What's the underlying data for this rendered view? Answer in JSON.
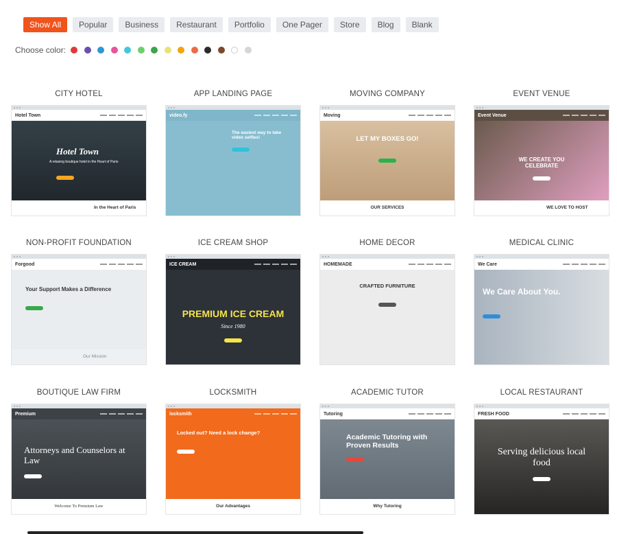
{
  "filters": [
    {
      "label": "Show All",
      "active": true
    },
    {
      "label": "Popular"
    },
    {
      "label": "Business"
    },
    {
      "label": "Restaurant"
    },
    {
      "label": "Portfolio"
    },
    {
      "label": "One Pager"
    },
    {
      "label": "Store"
    },
    {
      "label": "Blog"
    },
    {
      "label": "Blank"
    }
  ],
  "color_picker": {
    "label": "Choose color:",
    "colors": [
      "#e0393b",
      "#6a4fb0",
      "#2f97d4",
      "#e8559a",
      "#40c9d9",
      "#6fcf6a",
      "#3aa64a",
      "#e8e277",
      "#f2a413",
      "#ea6c49",
      "#2b2b2b",
      "#7b4a2b",
      "#ffffff",
      "#d6d6d6"
    ]
  },
  "templates": [
    {
      "title": "CITY HOTEL",
      "logo": "Hotel Town",
      "hero": "Hotel Town",
      "sub": "A relaxing boutique hotel in the Heart of Paris",
      "footer": "In the Heart of Paris"
    },
    {
      "title": "APP LANDING PAGE",
      "logo": "video.fy",
      "hero": "The easiest way to take video selfies!"
    },
    {
      "title": "MOVING COMPANY",
      "logo": "Moving",
      "hero": "LET MY BOXES GO!",
      "footer": "OUR SERVICES"
    },
    {
      "title": "EVENT VENUE",
      "logo": "Event Venue",
      "hero": "WE CREATE YOU CELEBRATE",
      "footer": "WE LOVE TO HOST"
    },
    {
      "title": "NON-PROFIT FOUNDATION",
      "logo": "Forgood",
      "hero": "Your Support Makes a Difference",
      "footer": "Our Mission"
    },
    {
      "title": "ICE CREAM SHOP",
      "logo": "ICE CREAM",
      "hero": "PREMIUM ICE CREAM",
      "sub": "Since 1980"
    },
    {
      "title": "HOME DECOR",
      "logo": "HOMEMADE",
      "hero": "CRAFTED FURNITURE"
    },
    {
      "title": "MEDICAL CLINIC",
      "logo": "We Care",
      "hero": "We Care About You."
    },
    {
      "title": "BOUTIQUE LAW FIRM",
      "logo": "Premium",
      "hero": "Attorneys and Counselors at Law",
      "footer": "Welcome To Premium Law"
    },
    {
      "title": "LOCKSMITH",
      "logo": "locksmith",
      "hero": "Locked out? Need a lock change?",
      "footer": "Our Advantages"
    },
    {
      "title": "ACADEMIC TUTOR",
      "logo": "Tutoring",
      "hero": "Academic Tutoring with Proven Results",
      "footer": "Why Tutoring"
    },
    {
      "title": "LOCAL RESTAURANT",
      "logo": "FRESH FOOD",
      "hero": "Serving delicious local food"
    }
  ]
}
